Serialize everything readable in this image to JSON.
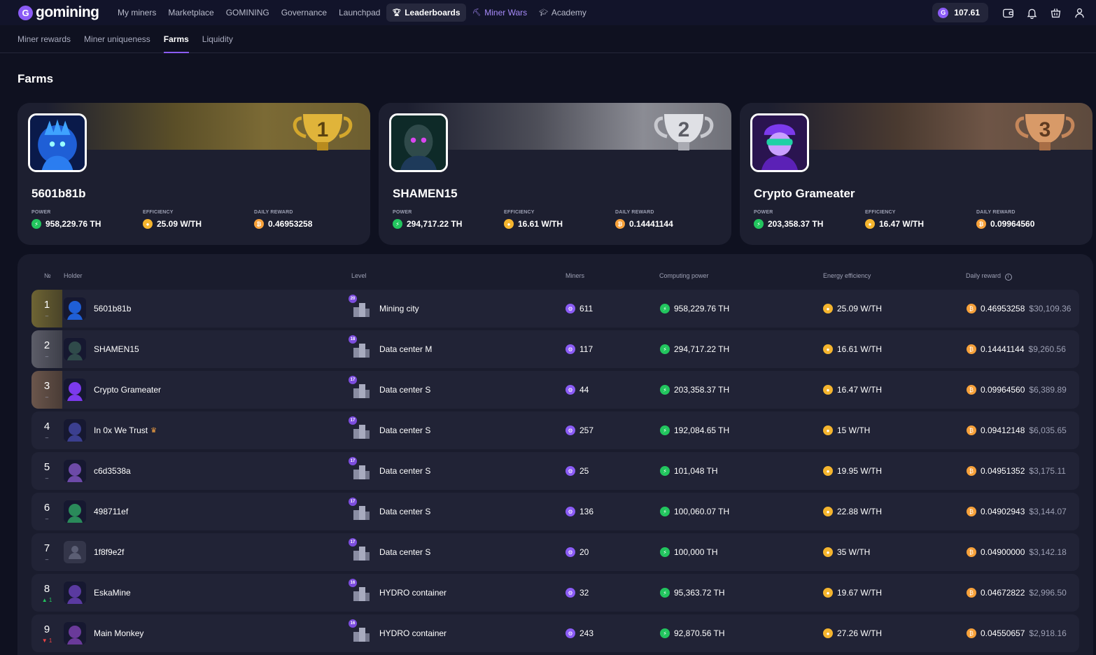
{
  "app": {
    "logo_text": "gomining",
    "nav": [
      {
        "label": "My miners"
      },
      {
        "label": "Marketplace"
      },
      {
        "label": "GOMINING"
      },
      {
        "label": "Governance"
      },
      {
        "label": "Launchpad"
      },
      {
        "label": "Leaderboards"
      },
      {
        "label": "Miner Wars"
      },
      {
        "label": "Academy"
      }
    ],
    "balance": "107.61"
  },
  "subnav": [
    {
      "label": "Miner rewards"
    },
    {
      "label": "Miner uniqueness"
    },
    {
      "label": "Farms"
    },
    {
      "label": "Liquidity"
    }
  ],
  "page_title": "Farms",
  "podium": [
    {
      "rank": "1",
      "name": "5601b81b",
      "power_label": "POWER",
      "power": "958,229.76 TH",
      "eff_label": "EFFICIENCY",
      "efficiency": "25.09 W/TH",
      "reward_label": "DAILY REWARD",
      "reward": "0.46953258"
    },
    {
      "rank": "2",
      "name": "SHAMEN15",
      "power_label": "POWER",
      "power": "294,717.22 TH",
      "eff_label": "EFFICIENCY",
      "efficiency": "16.61 W/TH",
      "reward_label": "DAILY REWARD",
      "reward": "0.14441144"
    },
    {
      "rank": "3",
      "name": "Crypto Grameater",
      "power_label": "POWER",
      "power": "203,358.37 TH",
      "eff_label": "EFFICIENCY",
      "efficiency": "16.47 W/TH",
      "reward_label": "DAILY REWARD",
      "reward": "0.09964560"
    }
  ],
  "table": {
    "headers": {
      "no": "№",
      "holder": "Holder",
      "level": "Level",
      "miners": "Miners",
      "power": "Computing power",
      "efficiency": "Energy efficiency",
      "reward": "Daily reward"
    },
    "rows": [
      {
        "rank": "1",
        "change": "–",
        "holder": "5601b81b",
        "level_num": "20",
        "level": "Mining city",
        "miners": "611",
        "power": "958,229.76 TH",
        "efficiency": "25.09 W/TH",
        "reward": "0.46953258",
        "usd": "$30,109.36"
      },
      {
        "rank": "2",
        "change": "–",
        "holder": "SHAMEN15",
        "level_num": "18",
        "level": "Data center M",
        "miners": "117",
        "power": "294,717.22 TH",
        "efficiency": "16.61 W/TH",
        "reward": "0.14441144",
        "usd": "$9,260.56"
      },
      {
        "rank": "3",
        "change": "–",
        "holder": "Crypto Grameater",
        "level_num": "17",
        "level": "Data center S",
        "miners": "44",
        "power": "203,358.37 TH",
        "efficiency": "16.47 W/TH",
        "reward": "0.09964560",
        "usd": "$6,389.89"
      },
      {
        "rank": "4",
        "change": "–",
        "holder": "In 0x We Trust",
        "level_num": "17",
        "level": "Data center S",
        "miners": "257",
        "power": "192,084.65 TH",
        "efficiency": "15 W/TH",
        "reward": "0.09412148",
        "usd": "$6,035.65"
      },
      {
        "rank": "5",
        "change": "–",
        "holder": "c6d3538a",
        "level_num": "17",
        "level": "Data center S",
        "miners": "25",
        "power": "101,048 TH",
        "efficiency": "19.95 W/TH",
        "reward": "0.04951352",
        "usd": "$3,175.11"
      },
      {
        "rank": "6",
        "change": "–",
        "holder": "498711ef",
        "level_num": "17",
        "level": "Data center S",
        "miners": "136",
        "power": "100,060.07 TH",
        "efficiency": "22.88 W/TH",
        "reward": "0.04902943",
        "usd": "$3,144.07"
      },
      {
        "rank": "7",
        "change": "–",
        "holder": "1f8f9e2f",
        "level_num": "17",
        "level": "Data center S",
        "miners": "20",
        "power": "100,000 TH",
        "efficiency": "35 W/TH",
        "reward": "0.04900000",
        "usd": "$3,142.18"
      },
      {
        "rank": "8",
        "change": "▲ 1",
        "holder": "EskaMine",
        "level_num": "16",
        "level": "HYDRO container",
        "miners": "32",
        "power": "95,363.72 TH",
        "efficiency": "19.67 W/TH",
        "reward": "0.04672822",
        "usd": "$2,996.50"
      },
      {
        "rank": "9",
        "change": "▼ 1",
        "holder": "Main Monkey",
        "level_num": "16",
        "level": "HYDRO container",
        "miners": "243",
        "power": "92,870.56 TH",
        "efficiency": "27.26 W/TH",
        "reward": "0.04550657",
        "usd": "$2,918.16"
      }
    ]
  },
  "colors": {
    "accent": "#8b5cf6",
    "power": "#22c55e",
    "efficiency": "#f5b52e",
    "reward": "#f7a13a",
    "background": "#0f1120"
  }
}
